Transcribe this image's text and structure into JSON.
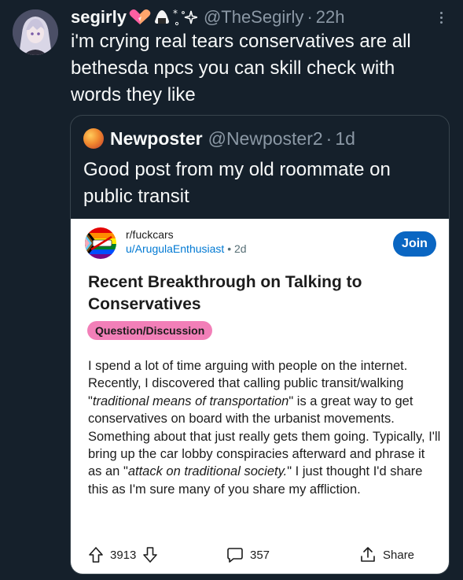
{
  "tweet": {
    "display_name": "segirly",
    "name_emoji": [
      "pink-heart-icon",
      "onigiri-icon",
      "sparkle-icon"
    ],
    "handle": "@TheSegirly",
    "separator": "·",
    "time": "22h",
    "text": "i'm crying real tears conservatives are all bethesda npcs you can skill check with words they like"
  },
  "quoted_tweet": {
    "display_name": "Newposter",
    "handle": "@Newposter2",
    "separator": "·",
    "time": "1d",
    "text": "Good post from my old roommate on public transit"
  },
  "reddit_post": {
    "subreddit": "r/fuckcars",
    "user": "u/ArugulaEnthusiast",
    "separator": "•",
    "age": "2d",
    "join_label": "Join",
    "title": "Recent Breakthrough on Talking to Conservatives",
    "flair": "Question/Discussion",
    "body": {
      "p1": "I spend a lot of time arguing with people on the internet. Recently, I discovered that calling public transit/walking \"",
      "em1": "traditional means of transportation",
      "p2": "\" is a great way to get conservatives on board with the urbanist movements. Something about that just really gets them going. Typically, I'll bring up the car lobby conspiracies afterward and phrase it as an \"",
      "em2": "attack on traditional society.",
      "p3": "\" I just thought I'd share this as I'm sure many of you share my affliction."
    },
    "upvotes": "3913",
    "comments": "357",
    "share_label": "Share"
  },
  "colors": {
    "background": "#15202b",
    "text": "#f7f9f9",
    "muted": "#8b98a5",
    "join_button": "#0a66c2",
    "flair": "#f27fb8"
  }
}
